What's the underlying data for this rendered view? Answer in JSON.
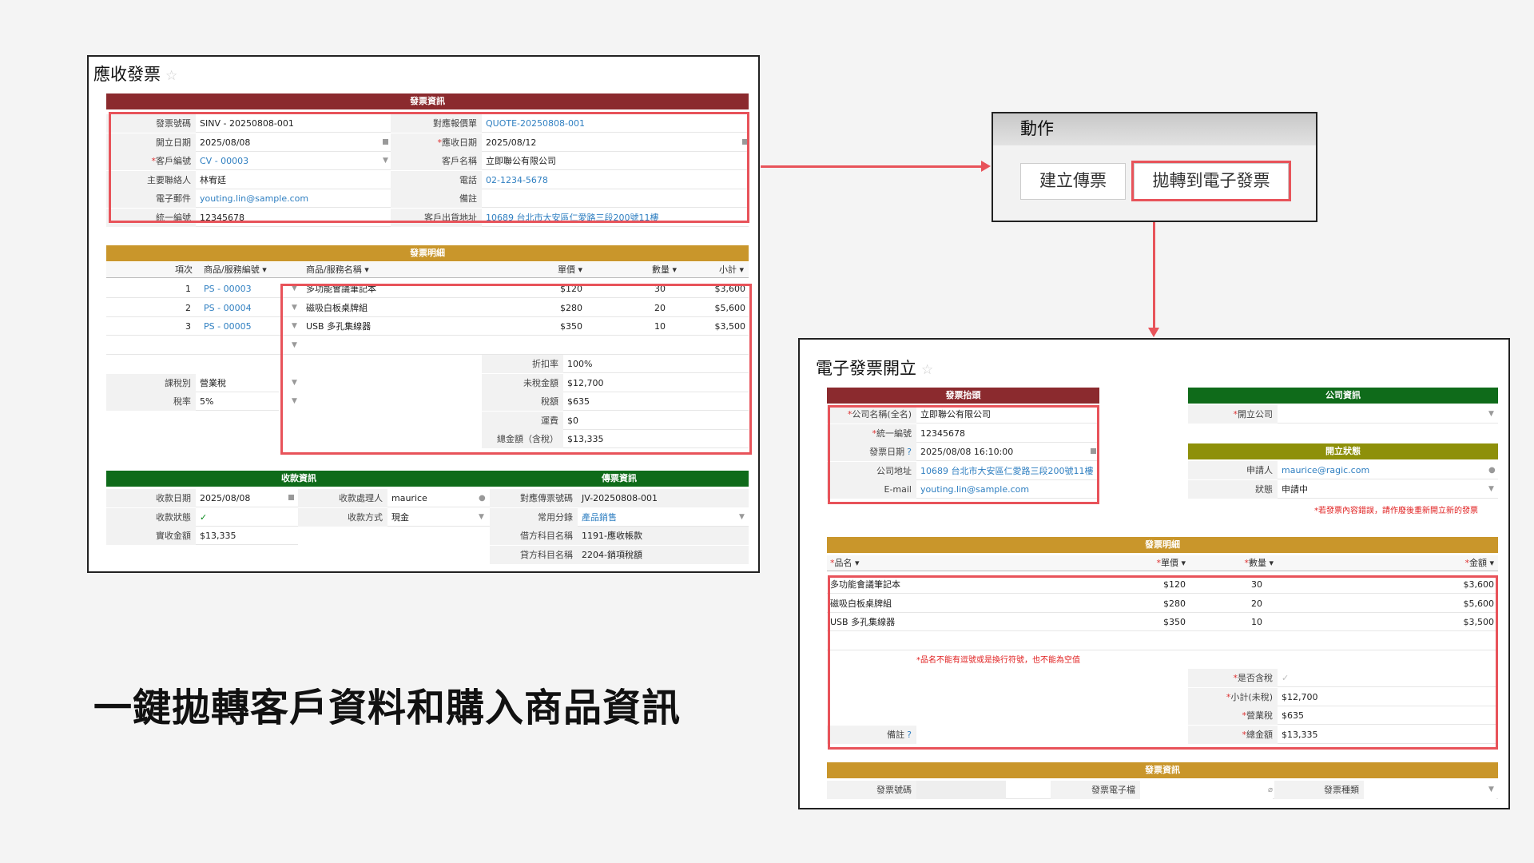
{
  "invoice_panel": {
    "title": "應收發票",
    "section_info": "發票資訊",
    "fields_left": [
      {
        "label": "發票號碼",
        "value": "SINV - 20250808-001",
        "required": false,
        "link": false
      },
      {
        "label": "開立日期",
        "value": "2025/08/08",
        "required": false,
        "link": false
      },
      {
        "label": "客戶編號",
        "value": "CV - 00003",
        "required": true,
        "link": true
      },
      {
        "label": "主要聯絡人",
        "value": "林宥廷",
        "required": false,
        "link": false
      },
      {
        "label": "電子郵件",
        "value": "youting.lin@sample.com",
        "required": false,
        "link": true
      },
      {
        "label": "統一編號",
        "value": "12345678",
        "required": false,
        "link": false
      }
    ],
    "fields_right": [
      {
        "label": "對應報價單",
        "value": "QUOTE-20250808-001",
        "required": false,
        "link": true
      },
      {
        "label": "應收日期",
        "value": "2025/08/12",
        "required": true,
        "link": false
      },
      {
        "label": "客戶名稱",
        "value": "立即聯公有限公司",
        "required": false,
        "link": false
      },
      {
        "label": "電話",
        "value": "02-1234-5678",
        "required": false,
        "link": true
      },
      {
        "label": "備註",
        "value": "",
        "required": false,
        "link": false
      },
      {
        "label": "客戶出貨地址",
        "value": "10689 台北市大安區仁愛路三段200號11樓",
        "required": false,
        "link": true
      }
    ],
    "section_items": "發票明細",
    "item_headers": [
      "項次",
      "商品/服務編號",
      "商品/服務名稱",
      "單價",
      "數量",
      "小計"
    ],
    "items": [
      {
        "no": "1",
        "code": "PS - 00003",
        "name": "多功能會議筆記本",
        "price": "$120",
        "qty": "30",
        "subtotal": "$3,600"
      },
      {
        "no": "2",
        "code": "PS - 00004",
        "name": "磁吸白板桌牌組",
        "price": "$280",
        "qty": "20",
        "subtotal": "$5,600"
      },
      {
        "no": "3",
        "code": "PS - 00005",
        "name": "USB 多孔集線器",
        "price": "$350",
        "qty": "10",
        "subtotal": "$3,500"
      }
    ],
    "tax_type_label": "課稅別",
    "tax_type": "營業稅",
    "tax_rate_label": "稅率",
    "tax_rate": "5%",
    "summary": [
      {
        "label": "折扣率",
        "value": "100%"
      },
      {
        "label": "未稅金額",
        "value": "$12,700"
      },
      {
        "label": "稅額",
        "value": "$635"
      },
      {
        "label": "運費",
        "value": "$0"
      },
      {
        "label": "總金額（含稅）",
        "value": "$13,335"
      }
    ],
    "section_payment": "收款資訊",
    "section_journal": "傳票資訊",
    "payment": {
      "date_label": "收款日期",
      "date": "2025/08/08",
      "handler_label": "收款處理人",
      "handler": "maurice",
      "status_label": "收款狀態",
      "status": "✓",
      "method_label": "收款方式",
      "method": "現金",
      "amount_label": "實收金額",
      "amount": "$13,335"
    },
    "journal": [
      {
        "label": "對應傳票號碼",
        "value": "JV-20250808-001",
        "link": false
      },
      {
        "label": "常用分錄",
        "value": "產品銷售",
        "link": true
      },
      {
        "label": "借方科目名稱",
        "value": "1191-應收帳款",
        "link": false
      },
      {
        "label": "貸方科目名稱",
        "value": "2204-銷項稅額",
        "link": false
      }
    ]
  },
  "action_panel": {
    "title": "動作",
    "buttons": [
      "建立傳票",
      "拋轉到電子發票"
    ]
  },
  "headline": "一鍵拋轉客戶資料和購入商品資訊",
  "einvoice_panel": {
    "title": "電子發票開立",
    "section_header": "發票抬頭",
    "header_fields": [
      {
        "label": "*公司名稱(全名)",
        "value": "立即聯公有限公司",
        "link": false
      },
      {
        "label": "*統一編號",
        "value": "12345678",
        "link": false
      },
      {
        "label": "發票日期",
        "value": "2025/08/08 16:10:00",
        "link": false
      },
      {
        "label": "公司地址",
        "value": "10689 台北市大安區仁愛路三段200號11樓",
        "link": true
      },
      {
        "label": "E-mail",
        "value": "youting.lin@sample.com",
        "link": true
      }
    ],
    "section_company": "公司資訊",
    "company_label": "*開立公司",
    "section_status": "開立狀態",
    "applicant_label": "申請人",
    "applicant": "maurice@ragic.com",
    "status_label": "狀態",
    "status": "申請中",
    "reissue_note": "*若發票內容錯誤，請作廢後重新開立新的發票",
    "section_items": "發票明細",
    "item_headers": [
      "*品名",
      "*單價",
      "*數量",
      "*金額"
    ],
    "items": [
      {
        "name": "多功能會議筆記本",
        "price": "$120",
        "qty": "30",
        "amount": "$3,600"
      },
      {
        "name": "磁吸白板桌牌組",
        "price": "$280",
        "qty": "20",
        "amount": "$5,600"
      },
      {
        "name": "USB 多孔集線器",
        "price": "$350",
        "qty": "10",
        "amount": "$3,500"
      }
    ],
    "item_note": "*品名不能有逗號或是換行符號，也不能為空值",
    "remark_label": "備註",
    "totals": [
      {
        "label": "*是否含稅",
        "value": "✓"
      },
      {
        "label": "*小計(未稅)",
        "value": "$12,700"
      },
      {
        "label": "*營業稅",
        "value": "$635"
      },
      {
        "label": "*總金額",
        "value": "$13,335"
      }
    ],
    "section_invoice": "發票資訊",
    "invoice_fields": [
      "發票號碼",
      "發票電子檔",
      "發票種類"
    ]
  },
  "colors": {
    "highlight": "#e8535a",
    "maroon": "#8b2a2e",
    "gold": "#c9962b",
    "green": "#0f6b1a",
    "olive": "#8e900a",
    "link": "#2f7fc1"
  }
}
